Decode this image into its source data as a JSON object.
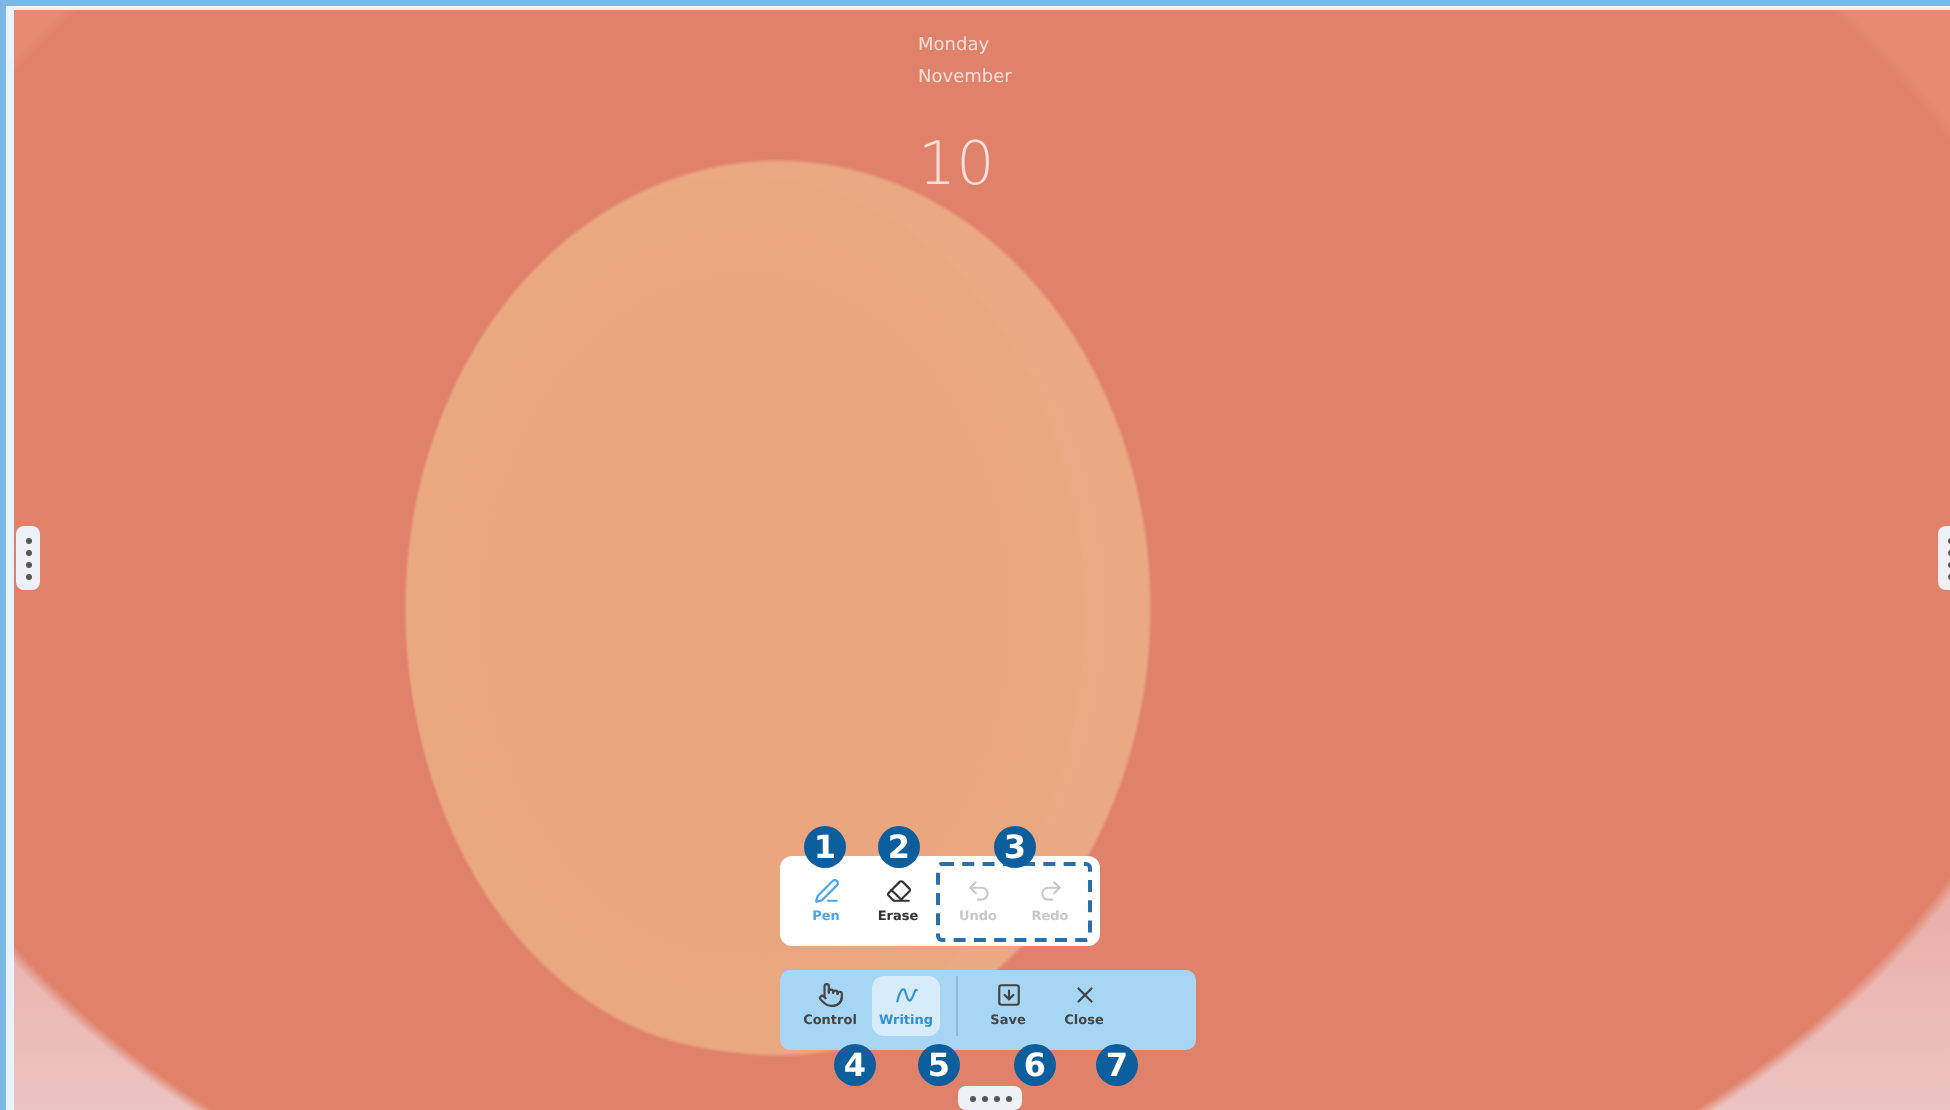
{
  "lock_screen": {
    "weekday": "Monday",
    "month": "November",
    "day": "10"
  },
  "pen_toolbar": {
    "tools": [
      {
        "kind": "pen",
        "label": "Pen",
        "selected": true
      },
      {
        "kind": "eraser",
        "label": "Erase",
        "selected": false
      }
    ],
    "history": [
      {
        "kind": "undo",
        "label": "Undo",
        "disabled": true
      },
      {
        "kind": "redo",
        "label": "Redo",
        "disabled": true
      }
    ]
  },
  "mode_toolbar": {
    "modes": [
      {
        "kind": "pointer",
        "label": "Control",
        "selected": false
      },
      {
        "kind": "writing",
        "label": "Writing",
        "selected": true
      }
    ],
    "actions": [
      {
        "kind": "save",
        "label": "Save"
      },
      {
        "kind": "close",
        "label": "Close"
      }
    ]
  },
  "callouts": [
    "1",
    "2",
    "3",
    "4",
    "5",
    "6",
    "7"
  ]
}
